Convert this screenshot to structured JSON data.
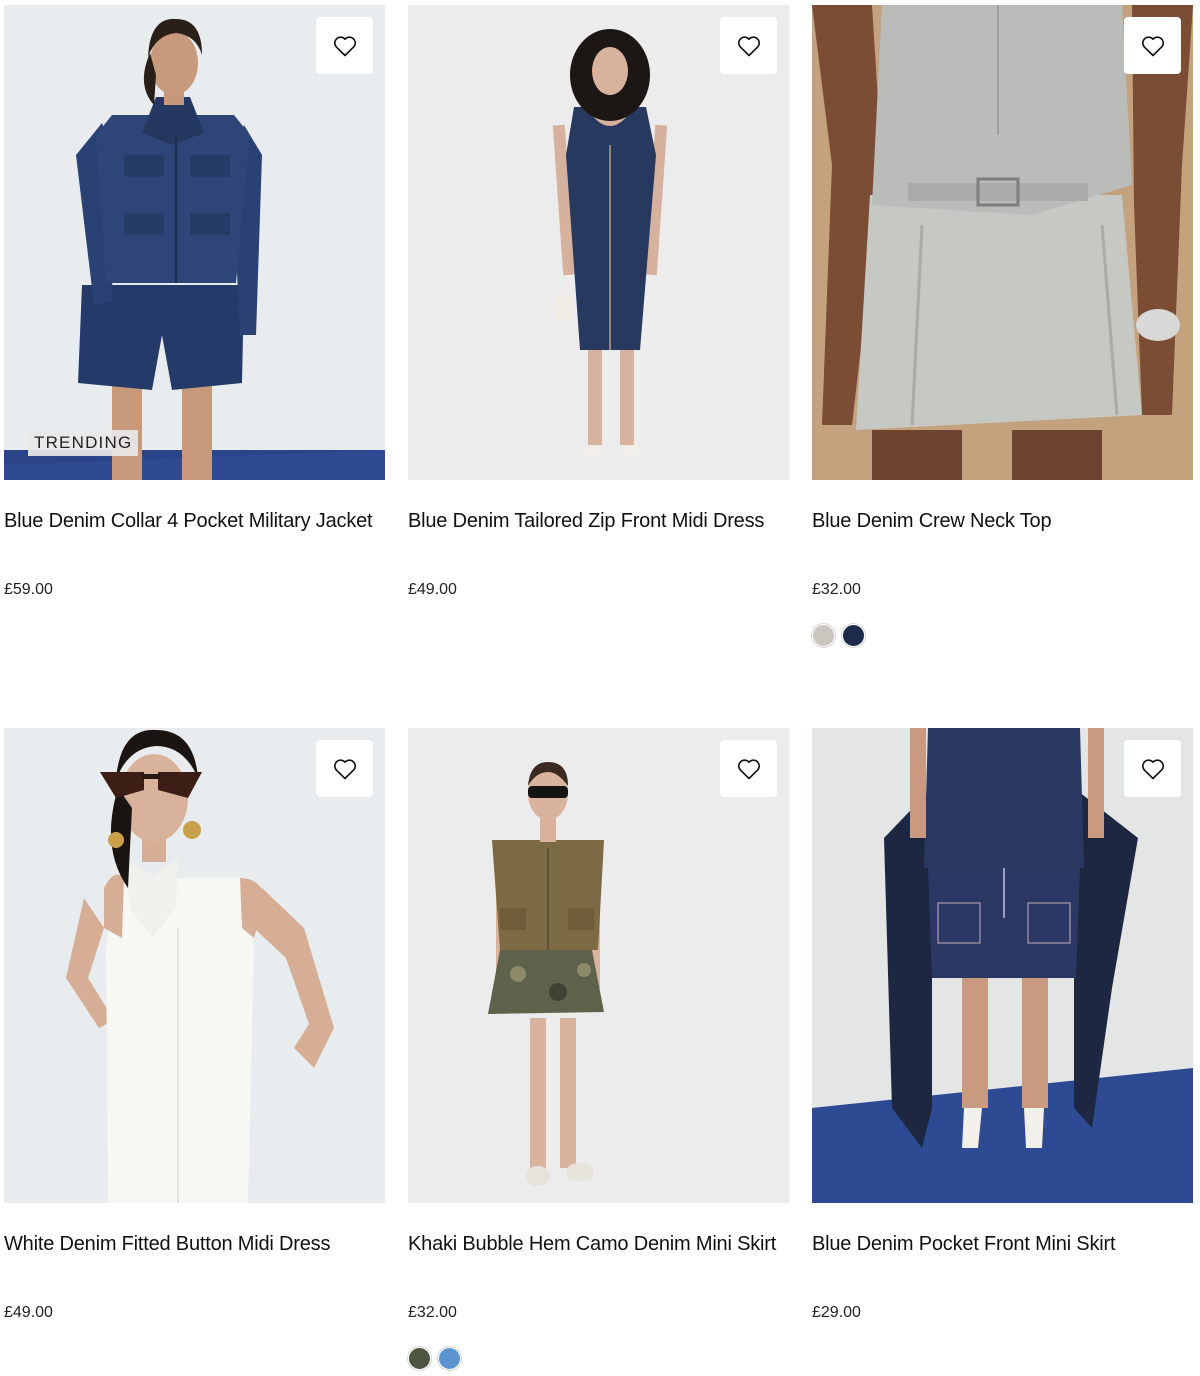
{
  "products": [
    {
      "name": "Blue Denim Collar 4 Pocket Military Jacket",
      "price": "£59.00",
      "badge": "TRENDING",
      "image": "model-denim-jacket-shorts",
      "swatches": []
    },
    {
      "name": "Blue Denim Tailored Zip Front Midi Dress",
      "price": "£49.00",
      "badge": null,
      "image": "model-denim-midi-dress",
      "swatches": []
    },
    {
      "name": "Blue Denim Crew Neck Top",
      "price": "£32.00",
      "badge": null,
      "image": "light-denim-top-skirt-closeup",
      "swatches": [
        "#c9c6c0",
        "#1e2a4a"
      ]
    },
    {
      "name": "White Denim Fitted Button Midi Dress",
      "price": "£49.00",
      "badge": null,
      "image": "model-white-halter-dress-sunglasses",
      "swatches": []
    },
    {
      "name": "Khaki Bubble Hem Camo Denim Mini Skirt",
      "price": "£32.00",
      "badge": null,
      "image": "model-khaki-vest-camo-skirt",
      "swatches": [
        "#4d5540",
        "#5b93d1"
      ]
    },
    {
      "name": "Blue Denim Pocket Front Mini Skirt",
      "price": "£29.00",
      "badge": null,
      "image": "denim-skirt-blue-carpet",
      "swatches": []
    }
  ],
  "icons": {
    "wishlist": "heart-outline-icon"
  }
}
